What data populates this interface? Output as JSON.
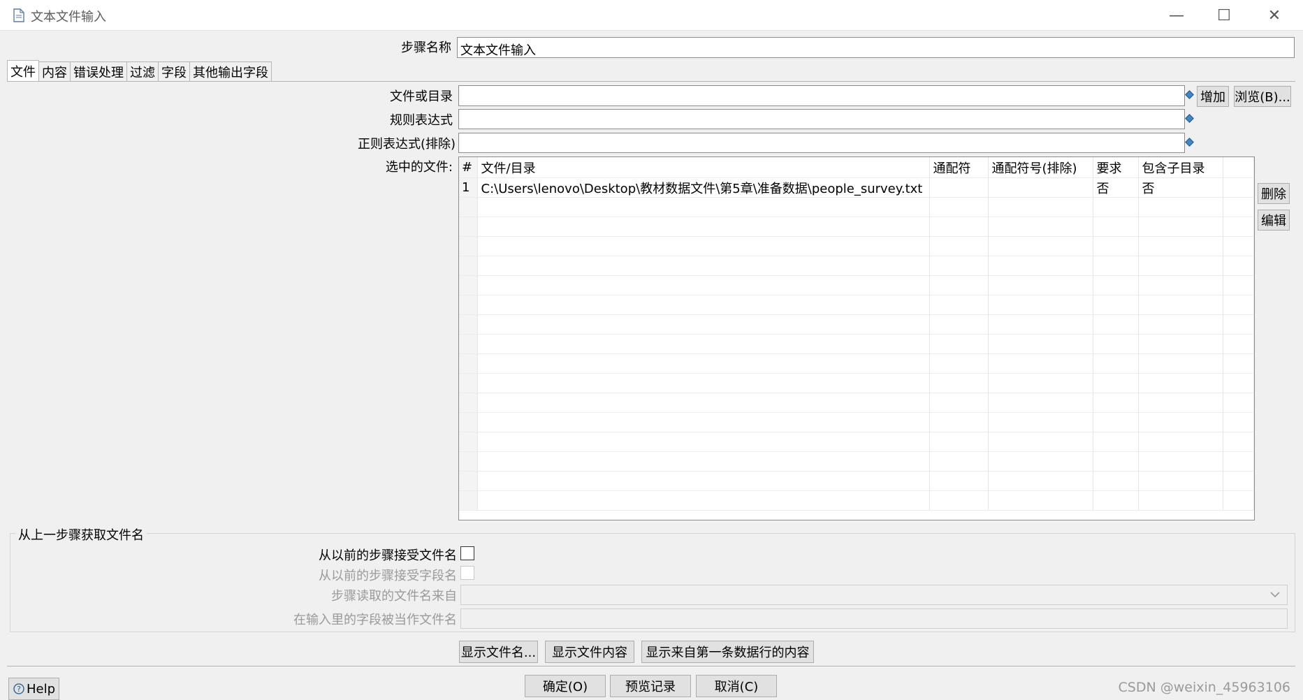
{
  "window": {
    "title": "文本文件输入",
    "minimize": "—",
    "maximize": "☐",
    "close": "✕"
  },
  "step": {
    "label": "步骤名称",
    "value": "文本文件输入"
  },
  "tabs": [
    {
      "label": "文件",
      "active": true
    },
    {
      "label": "内容"
    },
    {
      "label": "错误处理"
    },
    {
      "label": "过滤"
    },
    {
      "label": "字段"
    },
    {
      "label": "其他输出字段"
    }
  ],
  "file_tab": {
    "file_or_dir_label": "文件或目录",
    "file_or_dir_value": "",
    "regex_label": "规则表达式",
    "regex_value": "",
    "regex_exclude_label": "正则表达式(排除)",
    "regex_exclude_value": "",
    "add_button": "增加",
    "browse_button": "浏览(B)...",
    "selected_files_label": "选中的文件:",
    "delete_button": "删除",
    "edit_button": "编辑",
    "table": {
      "columns": [
        "#",
        "文件/目录",
        "通配符",
        "通配符号(排除)",
        "要求",
        "包含子目录"
      ],
      "rows": [
        [
          "1",
          "C:\\Users\\lenovo\\Desktop\\教材数据文件\\第5章\\准备数据\\people_survey.txt",
          "",
          "",
          "否",
          "否"
        ]
      ],
      "empty_rows": 16
    }
  },
  "prev_step": {
    "group_title": "从上一步骤获取文件名",
    "accept_filenames_label": "从以前的步骤接受文件名",
    "accept_filenames_checked": false,
    "accept_fieldnames_label": "从以前的步骤接受字段名",
    "read_from_label": "步骤读取的文件名来自",
    "read_from_value": "",
    "field_as_filename_label": "在输入里的字段被当作文件名",
    "field_as_filename_value": ""
  },
  "show_buttons": {
    "show_filenames": "显示文件名...",
    "show_content": "显示文件内容",
    "show_first_row": "显示来自第一条数据行的内容"
  },
  "footer": {
    "help": "Help",
    "ok": "确定(O)",
    "preview": "预览记录",
    "cancel": "取消(C)"
  },
  "watermark": "CSDN @weixin_45963106"
}
